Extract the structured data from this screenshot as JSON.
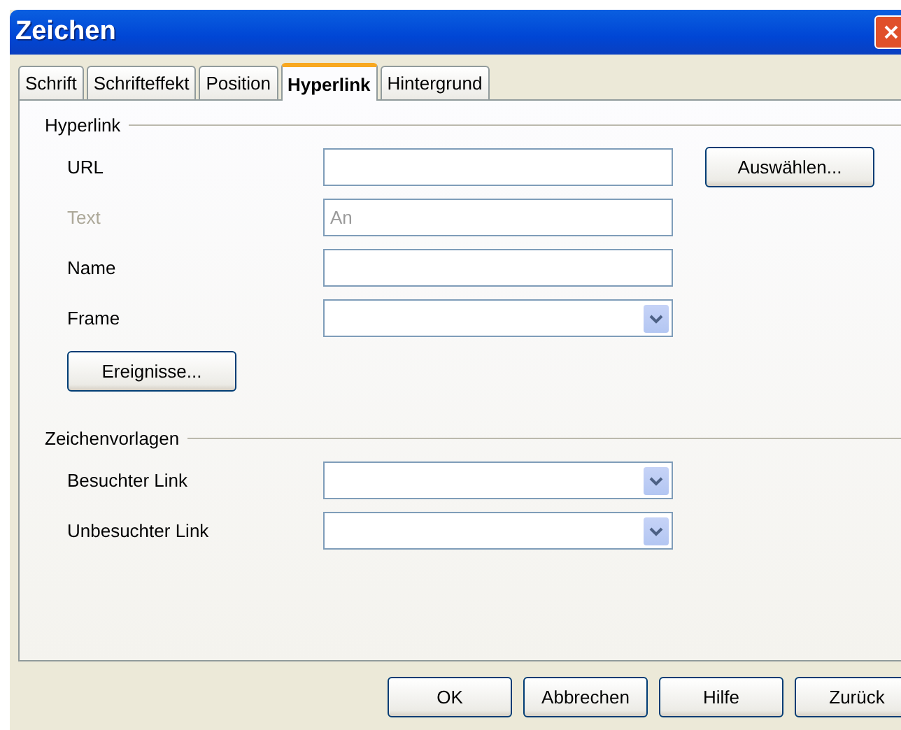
{
  "window": {
    "title": "Zeichen"
  },
  "tabs": [
    {
      "label": "Schrift",
      "selected": false
    },
    {
      "label": "Schrifteffekt",
      "selected": false
    },
    {
      "label": "Position",
      "selected": false
    },
    {
      "label": "Hyperlink",
      "selected": true
    },
    {
      "label": "Hintergrund",
      "selected": false
    }
  ],
  "hyperlink": {
    "title": "Hyperlink",
    "fields": [
      {
        "label": "URL",
        "kind": "text",
        "disabled": false,
        "button": "Auswählen..."
      },
      {
        "label": "Text",
        "kind": "text",
        "disabled": true,
        "value": "An"
      },
      {
        "label": "Name",
        "kind": "text",
        "disabled": false
      },
      {
        "label": "Frame",
        "kind": "combo",
        "disabled": false
      }
    ],
    "button": "Ereignisse..."
  },
  "character_styles": {
    "title": "Zeichenvorlagen",
    "fields": [
      {
        "label": "Besuchter Link",
        "kind": "combo",
        "disabled": false
      },
      {
        "label": "Unbesuchter Link",
        "kind": "combo",
        "disabled": false
      }
    ]
  },
  "buttons": [
    "OK",
    "Abbrechen",
    "Hilfe",
    "Zurück"
  ]
}
